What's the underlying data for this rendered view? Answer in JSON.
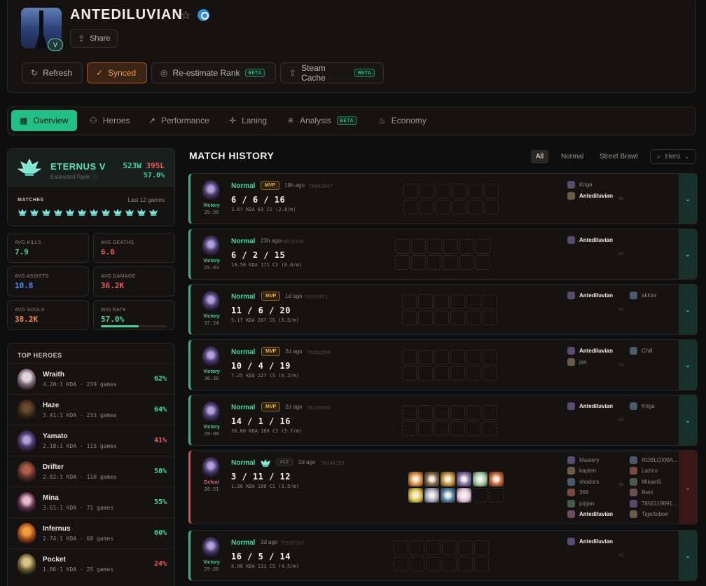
{
  "header": {
    "player_name": "ANTEDILUVIAN",
    "avatar_badge": "V",
    "share_label": "Share",
    "actions": [
      {
        "label": "Refresh",
        "icon": "refresh-icon"
      },
      {
        "label": "Synced",
        "icon": "check-icon",
        "active": true
      },
      {
        "label": "Re-estimate Rank",
        "icon": "target-icon",
        "badge": "BETA"
      },
      {
        "label": "Steam Cache",
        "icon": "upload-icon",
        "badge": "BETA"
      }
    ]
  },
  "tabs": [
    {
      "label": "Overview",
      "icon": "grid-icon",
      "active": true
    },
    {
      "label": "Heroes",
      "icon": "user-icon"
    },
    {
      "label": "Performance",
      "icon": "trend-icon"
    },
    {
      "label": "Laning",
      "icon": "crosshair-icon"
    },
    {
      "label": "Analysis",
      "icon": "sparkle-icon",
      "badge": "BETA"
    },
    {
      "label": "Economy",
      "icon": "flame-icon"
    }
  ],
  "rank": {
    "name": "ETERNUS V",
    "subtitle": "Estimated Rank",
    "wins": "523W",
    "losses": "395L",
    "winrate": "57.0%",
    "matches_label": "MATCHES",
    "last_label": "Last 12 games",
    "recent_count": 12
  },
  "stats": [
    {
      "label": "AVG KILLS",
      "value": "7.9",
      "color": "#3fd6a0"
    },
    {
      "label": "AVG DEATHS",
      "value": "6.0",
      "color": "#ef5a5a"
    },
    {
      "label": "AVG ASSISTS",
      "value": "10.8",
      "color": "#4b8ef0"
    },
    {
      "label": "AVG DAMAGE",
      "value": "36.2K",
      "color": "#ef5a5a"
    },
    {
      "label": "AVG SOULS",
      "value": "38.2K",
      "color": "#f28a2e"
    },
    {
      "label": "WIN RATE",
      "value": "57.0%",
      "color": "#3fd6a0",
      "progress": 0.57
    }
  ],
  "top_heroes": {
    "title": "TOP HEROES",
    "items": [
      {
        "name": "Wraith",
        "sub": "4.20:1 KDA · 239 games",
        "wr": "62%",
        "wr_color": "#3fd6a0"
      },
      {
        "name": "Haze",
        "sub": "3.41:1 KDA · 233 games",
        "wr": "64%",
        "wr_color": "#3fd6a0"
      },
      {
        "name": "Yamato",
        "sub": "2.18:1 KDA · 115 games",
        "wr": "41%",
        "wr_color": "#ef5a5a"
      },
      {
        "name": "Drifter",
        "sub": "2.82:1 KDA · 110 games",
        "wr": "58%",
        "wr_color": "#3fd6a0"
      },
      {
        "name": "Mina",
        "sub": "3.61:1 KDA · 71 games",
        "wr": "55%",
        "wr_color": "#3fd6a0"
      },
      {
        "name": "Infernus",
        "sub": "2.74:1 KDA · 68 games",
        "wr": "60%",
        "wr_color": "#3fd6a0"
      },
      {
        "name": "Pocket",
        "sub": "1.86:1 KDA · 25 games",
        "wr": "24%",
        "wr_color": "#ef5a5a"
      }
    ]
  },
  "match_history": {
    "title": "MATCH HISTORY",
    "filters": [
      "All",
      "Normal",
      "Street Brawl"
    ],
    "hero_filter": "Hero",
    "vs_label": "vs",
    "matches": [
      {
        "result": "Victory",
        "duration": "29:56",
        "mode": "Normal",
        "mvp": "MVP",
        "ago": "19h ago",
        "id": "76663847",
        "kda": "6 / 6 / 16",
        "sub": "3.67 KDA  83 CS (2.8/m)",
        "team_a": [
          {
            "name": "Kriga"
          },
          {
            "name": "Antediluvian",
            "self": true
          }
        ],
        "team_b": []
      },
      {
        "result": "Victory",
        "duration": "25:03",
        "mode": "Normal",
        "ago": "23h ago",
        "id": "76613756",
        "kda": "6 / 2 / 15",
        "sub": "10.50 KDA  171 CS (6.8/m)",
        "team_a": [
          {
            "name": "Antediluvian",
            "self": true
          }
        ],
        "team_b": []
      },
      {
        "result": "Victory",
        "duration": "37:24",
        "mode": "Normal",
        "mvp": "MVP",
        "ago": "1d ago",
        "id": "76391971",
        "kda": "11 / 6 / 20",
        "sub": "5.17 KDA  207 CS (5.5/m)",
        "team_a": [
          {
            "name": "Antediluvian",
            "self": true
          }
        ],
        "team_b": [
          {
            "name": "akkira"
          }
        ]
      },
      {
        "result": "Victory",
        "duration": "36:36",
        "mode": "Normal",
        "mvp": "MVP",
        "ago": "2d ago",
        "id": "76202396",
        "kda": "10 / 4 / 19",
        "sub": "7.25 KDA  227 CS (6.2/m)",
        "team_a": [
          {
            "name": "Antediluvian",
            "self": true
          },
          {
            "name": "jan"
          }
        ],
        "team_b": [
          {
            "name": "Chill"
          }
        ]
      },
      {
        "result": "Victory",
        "duration": "29:08",
        "mode": "Normal",
        "mvp": "MVP",
        "ago": "2d ago",
        "id": "76195942",
        "kda": "14 / 1 / 16",
        "sub": "30.00 KDA  166 CS (5.7/m)",
        "team_a": [
          {
            "name": "Antediluvian",
            "self": true
          }
        ],
        "team_b": [
          {
            "name": "Kriga"
          }
        ]
      },
      {
        "result": "Defeat",
        "duration": "28:51",
        "mode": "Normal",
        "place": "#12",
        "ago": "2d ago",
        "id": "76146153",
        "kda": "3 / 11 / 12",
        "sub": "1.36 KDA  100 CS (3.5/m)",
        "team_a": [
          {
            "name": "Mastery"
          },
          {
            "name": "kapten"
          },
          {
            "name": "shadors"
          },
          {
            "name": "369"
          },
          {
            "name": "pidjan"
          },
          {
            "name": "Antediluvian",
            "self": true
          }
        ],
        "team_b": [
          {
            "name": "ROBLOXMA..."
          },
          {
            "name": "Lazico"
          },
          {
            "name": "MikaelS"
          },
          {
            "name": "Reni"
          },
          {
            "name": "7656119891..."
          },
          {
            "name": "Tigertoboe"
          }
        ]
      },
      {
        "result": "Victory",
        "duration": "29:26",
        "mode": "Normal",
        "ago": "3d ago",
        "id": "75997107",
        "kda": "16 / 5 / 14",
        "sub": "6.00 KDA  131 CS (4.5/m)",
        "team_a": [
          {
            "name": "Antediluvian",
            "self": true
          }
        ],
        "team_b": []
      }
    ]
  }
}
